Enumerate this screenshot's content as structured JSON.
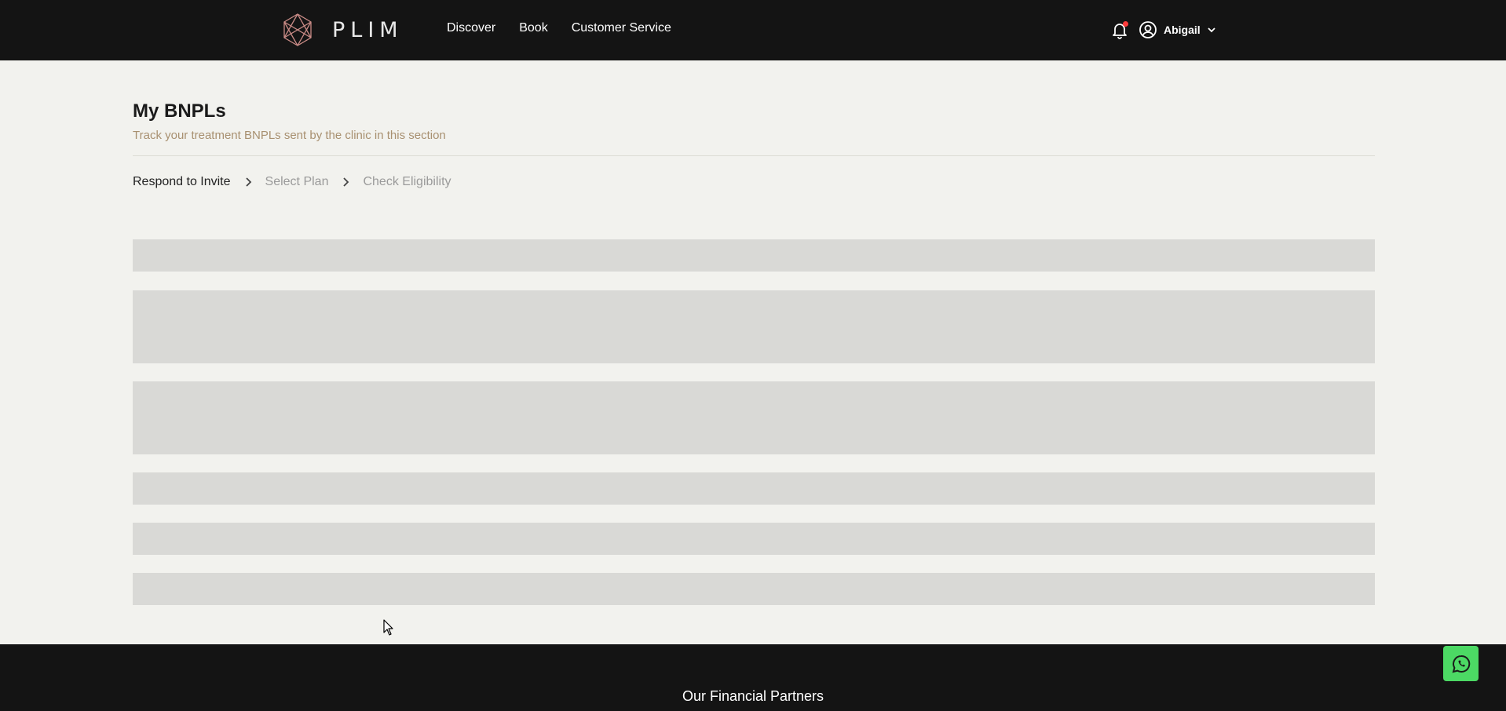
{
  "header": {
    "logo_text": "PLIM",
    "nav": [
      {
        "label": "Discover"
      },
      {
        "label": "Book"
      },
      {
        "label": "Customer Service"
      }
    ],
    "user_name": "Abigail",
    "notification_dot_color": "#ff3b3b"
  },
  "main": {
    "title": "My BNPLs",
    "subtitle": "Track your treatment BNPLs sent by the clinic in this section",
    "steps": [
      {
        "label": "Respond to Invite"
      },
      {
        "label": "Select Plan"
      },
      {
        "label": "Check Eligibility"
      }
    ]
  },
  "footer": {
    "title": "Our Financial Partners"
  },
  "colors": {
    "topbar": "#141414",
    "background": "#f2f2ee",
    "skeleton": "#d9d9d6",
    "whatsapp": "#4cd964",
    "subtitle": "#a89070"
  },
  "icons": [
    "logo-icon",
    "bell-icon",
    "user-circle-icon",
    "chevron-down-icon",
    "chevron-right-icon",
    "whatsapp-icon",
    "cursor-icon"
  ]
}
